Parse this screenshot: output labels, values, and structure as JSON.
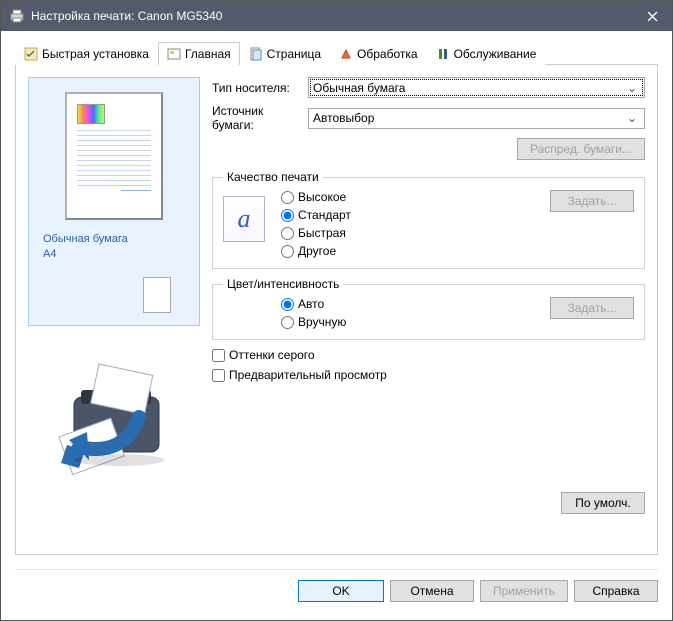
{
  "title": "Настройка печати: Canon MG5340",
  "tabs": [
    {
      "label": "Быстрая установка"
    },
    {
      "label": "Главная"
    },
    {
      "label": "Страница"
    },
    {
      "label": "Обработка"
    },
    {
      "label": "Обслуживание"
    }
  ],
  "preview": {
    "media": "Обычная бумага",
    "size": "A4"
  },
  "fields": {
    "media_type_label": "Тип носителя:",
    "media_type_value": "Обычная бумага",
    "paper_source_label": "Источник бумаги:",
    "paper_source_value": "Автовыбор",
    "paper_alloc_btn": "Распред. бумаги..."
  },
  "quality": {
    "legend": "Качество печати",
    "options": {
      "high": "Высокое",
      "standard": "Стандарт",
      "fast": "Быстрая",
      "other": "Другое"
    },
    "set_btn": "Задать..."
  },
  "color": {
    "legend": "Цвет/интенсивность",
    "options": {
      "auto": "Авто",
      "manual": "Вручную"
    },
    "set_btn": "Задать..."
  },
  "checkboxes": {
    "grayscale": "Оттенки серого",
    "preview": "Предварительный просмотр"
  },
  "defaults_btn": "По умолч.",
  "dialog": {
    "ok": "OK",
    "cancel": "Отмена",
    "apply": "Применить",
    "help": "Справка"
  }
}
